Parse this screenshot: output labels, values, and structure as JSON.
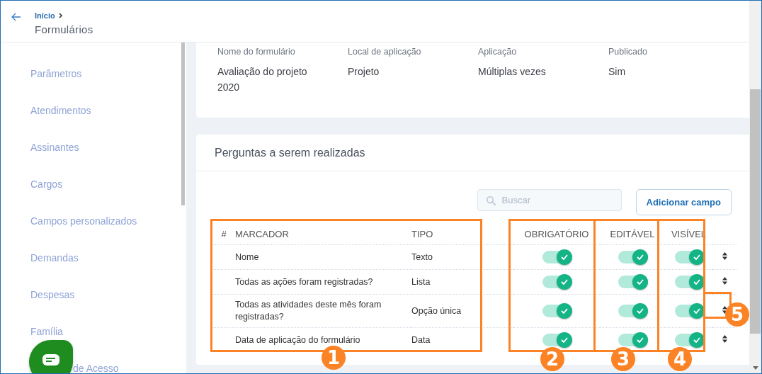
{
  "header": {
    "breadcrumb": [
      {
        "label": "Início"
      }
    ],
    "title": "Formulários"
  },
  "sidebar": {
    "items": [
      {
        "label": "Parâmetros"
      },
      {
        "label": "Atendimentos"
      },
      {
        "label": "Assinantes"
      },
      {
        "label": "Cargos"
      },
      {
        "label": "Campos personalizados"
      },
      {
        "label": "Demandas"
      },
      {
        "label": "Despesas"
      },
      {
        "label": "Família"
      },
      {
        "label": "de Acesso"
      }
    ]
  },
  "form_info": {
    "fields": [
      {
        "label": "Nome do formulário",
        "value": "Avaliação do projeto 2020"
      },
      {
        "label": "Local de aplicação",
        "value": "Projeto"
      },
      {
        "label": "Aplicação",
        "value": "Múltiplas vezes"
      },
      {
        "label": "Publicado",
        "value": "Sim"
      }
    ]
  },
  "questions": {
    "title": "Perguntas a serem realizadas",
    "search": {
      "placeholder": "Buscar"
    },
    "add_button": "Adicionar campo",
    "columns": [
      "#",
      "MARCADOR",
      "TIPO",
      "OBRIGATÓRIO",
      "EDITÁVEL",
      "VISÍVEL"
    ],
    "rows": [
      {
        "label": "Nome",
        "type": "Texto",
        "required": true,
        "editable": true,
        "visible": true
      },
      {
        "label": "Todas as ações foram registradas?",
        "type": "Lista",
        "required": true,
        "editable": true,
        "visible": true
      },
      {
        "label": "Todas as atividades deste mês foram registradas?",
        "type": "Opção única",
        "required": true,
        "editable": true,
        "visible": true
      },
      {
        "label": "Data de aplicação do formulário",
        "type": "Data",
        "required": true,
        "editable": true,
        "visible": true
      }
    ]
  },
  "annotations": [
    {
      "number": "1"
    },
    {
      "number": "2"
    },
    {
      "number": "3"
    },
    {
      "number": "4"
    },
    {
      "number": "5"
    }
  ]
}
